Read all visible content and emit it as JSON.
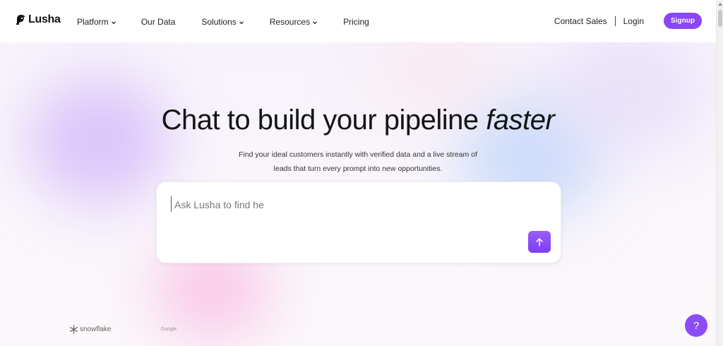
{
  "brand": {
    "name": "Lusha",
    "accent": "#8b46f5"
  },
  "nav": {
    "items": [
      {
        "label": "Platform",
        "dropdown": true
      },
      {
        "label": "Our Data",
        "dropdown": false
      },
      {
        "label": "Solutions",
        "dropdown": true
      },
      {
        "label": "Resources",
        "dropdown": true
      },
      {
        "label": "Pricing",
        "dropdown": false
      }
    ],
    "contact_sales": "Contact Sales",
    "login": "Login",
    "signup": "Signup"
  },
  "hero": {
    "headline_main": "Chat to build your pipeline",
    "headline_italic": "faster",
    "subline_1": "Find your ideal customers instantly with verified data and a live stream of",
    "subline_2": "leads that turn every prompt into new opportunities."
  },
  "chat": {
    "text": "Ask Lusha to find he",
    "send_icon": "arrow-up-icon"
  },
  "logos": {
    "snowflake": "snowflake",
    "google": "Google"
  },
  "help": {
    "label": "?"
  }
}
